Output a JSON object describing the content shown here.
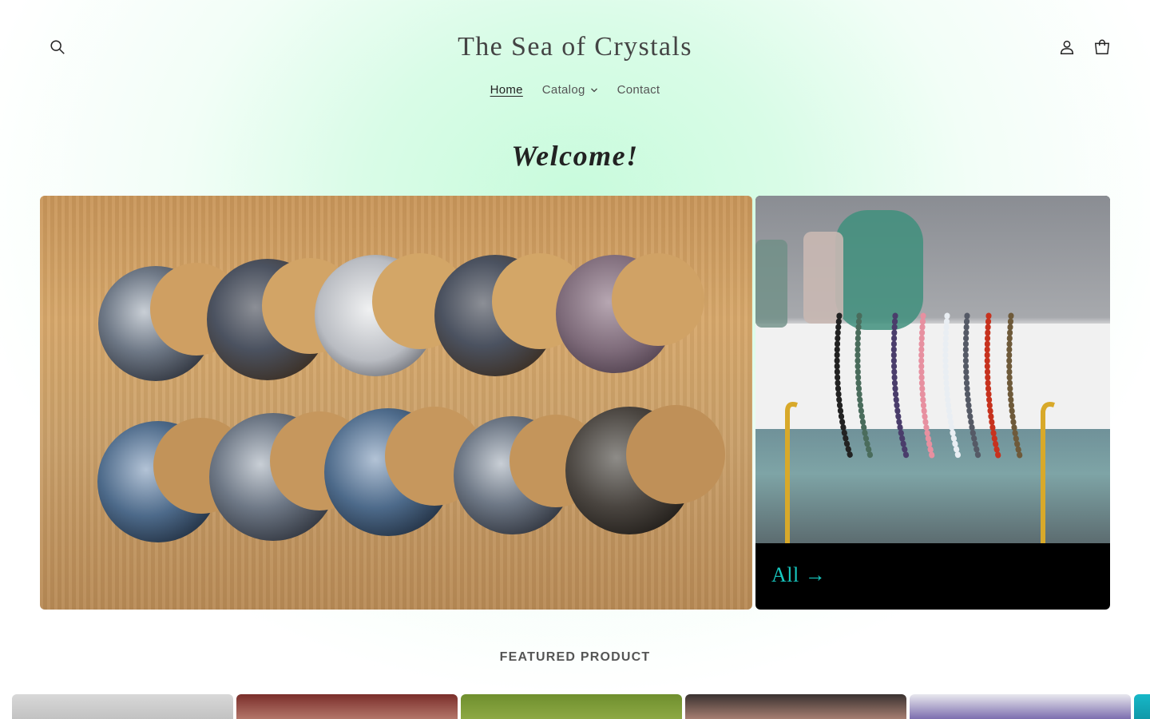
{
  "header": {
    "store_name": "The Sea of Crystals",
    "icons": [
      "search-icon",
      "account-icon",
      "cart-icon"
    ]
  },
  "nav": {
    "items": [
      {
        "label": "Home",
        "active": true
      },
      {
        "label": "Catalog",
        "dropdown": true
      },
      {
        "label": "Contact"
      }
    ]
  },
  "hero": {
    "heading": "Welcome!",
    "collection_link": "All →"
  },
  "featured": {
    "heading": "FEATURED PRODUCT"
  },
  "colors": {
    "accent": "#17c8c0",
    "background_glow": "#c8fbdc"
  }
}
